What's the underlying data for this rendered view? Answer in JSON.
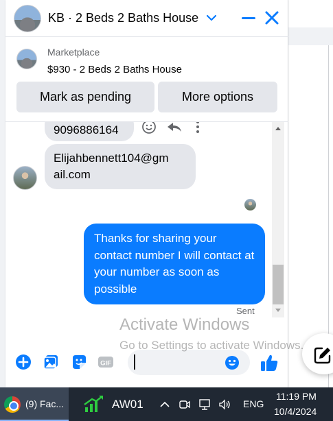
{
  "chat": {
    "title": "KB · 2 Beds 2 Baths House",
    "listing": {
      "source": "Marketplace",
      "name": "$930 - 2 Beds 2 Baths House",
      "mark_pending_label": "Mark as pending",
      "more_options_label": "More options"
    },
    "messages": [
      {
        "from": "them",
        "text": "9096886164"
      },
      {
        "from": "them",
        "text": "Elijahbennett104@gm ail.com"
      },
      {
        "from": "me",
        "text": "Thanks for sharing your contact number I will contact at your number as soon as possible"
      }
    ],
    "status": "Sent",
    "composer": {
      "placeholder": ""
    }
  },
  "watermark": {
    "line1": "Activate Windows",
    "line2": "Go to Settings to activate Windows."
  },
  "taskbar": {
    "browser_label": "(9) Fac...",
    "app_label": "AW01",
    "lang": "ENG",
    "time": "11:19 PM",
    "date": "10/4/2024"
  },
  "colors": {
    "messenger_blue": "#0a7cff",
    "bubble_gray": "#e4e6eb",
    "taskbar": "#202833"
  },
  "icons": [
    "chevron-down-icon",
    "minimize-icon",
    "close-icon",
    "emoji-icon",
    "reply-icon",
    "more-icon",
    "plus-icon",
    "photo-icon",
    "sticker-icon",
    "gif-icon",
    "like-icon",
    "compose-icon"
  ]
}
